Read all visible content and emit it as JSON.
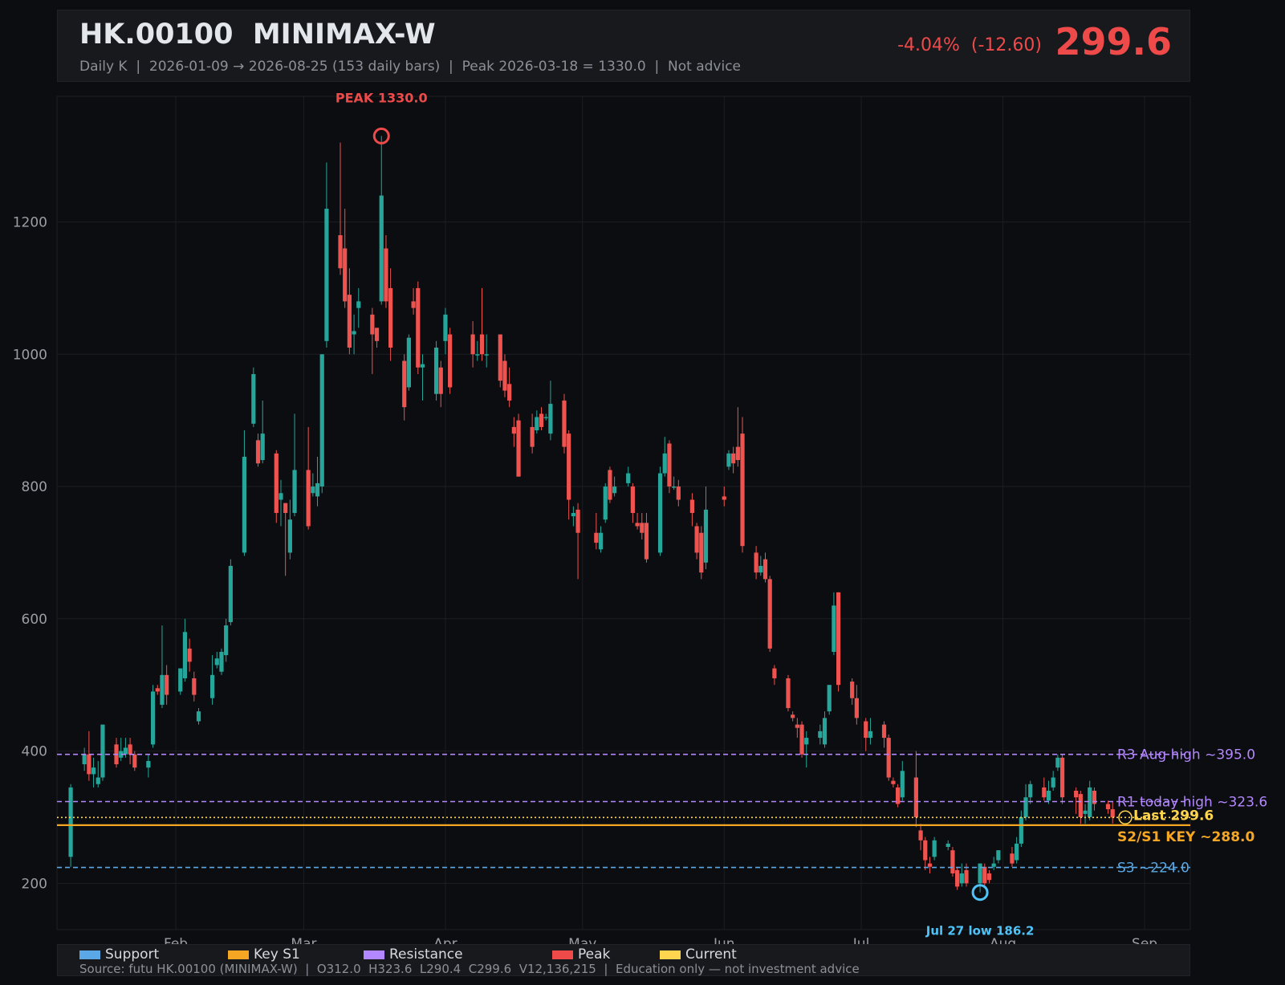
{
  "header": {
    "symbol": "HK.00100  MINIMAX-W",
    "subtitle": "Daily K  |  2026-01-09 → 2026-08-25 (153 daily bars)  |  Peak 2026-03-18 = 1330.0  |  Not advice",
    "change": "-4.04%  (-12.60)",
    "last": "299.6"
  },
  "colors": {
    "up": "#26a69a",
    "down": "#ef5350",
    "support": "#5aa9e6",
    "key": "#f5a623",
    "resistance": "#b388ff",
    "peak": "#ef4a4a",
    "current": "#ffd54f"
  },
  "chart_data": {
    "type": "candlestick",
    "ylim": [
      130,
      1390
    ],
    "yticks": [
      200,
      400,
      600,
      800,
      1000,
      1200
    ],
    "xticks": [
      {
        "label": "Feb",
        "date": "2026-02-01"
      },
      {
        "label": "Mar",
        "date": "2026-03-01"
      },
      {
        "label": "Apr",
        "date": "2026-04-01"
      },
      {
        "label": "May",
        "date": "2026-05-01"
      },
      {
        "label": "Jun",
        "date": "2026-06-01"
      },
      {
        "label": "Jul",
        "date": "2026-07-01"
      },
      {
        "label": "Aug",
        "date": "2026-08-01"
      },
      {
        "label": "Sep",
        "date": "2026-09-01"
      }
    ],
    "xrange": [
      "2026-01-06",
      "2026-09-11"
    ],
    "levels": [
      {
        "label": "R3 Aug high ~395.0",
        "value": 395.0,
        "kind": "resistance",
        "style": "dashed"
      },
      {
        "label": "R1 today high ~323.6",
        "value": 323.6,
        "kind": "resistance",
        "style": "dashed"
      },
      {
        "label": "Last 299.6",
        "value": 299.6,
        "kind": "current",
        "style": "dotted"
      },
      {
        "label": "S2/S1 KEY ~288.0",
        "value": 288.0,
        "kind": "key",
        "style": "solid"
      },
      {
        "label": "S3 ~224.0",
        "value": 224.0,
        "kind": "support",
        "style": "dashed"
      }
    ],
    "peak": {
      "label": "PEAK 1330.0",
      "date": "2026-03-18",
      "value": 1330.0
    },
    "low": {
      "label": "Jul 27 low 186.2",
      "date": "2026-07-27",
      "value": 186.2
    },
    "candles": [
      [
        "2026-01-09",
        240,
        345,
        350,
        225
      ],
      [
        "2026-01-12",
        380,
        395,
        405,
        370
      ],
      [
        "2026-01-13",
        395,
        365,
        430,
        355
      ],
      [
        "2026-01-14",
        365,
        375,
        390,
        345
      ],
      [
        "2026-01-15",
        350,
        360,
        385,
        345
      ],
      [
        "2026-01-16",
        360,
        440,
        440,
        355
      ],
      [
        "2026-01-19",
        410,
        380,
        420,
        375
      ],
      [
        "2026-01-20",
        390,
        400,
        420,
        385
      ],
      [
        "2026-01-21",
        395,
        405,
        420,
        390
      ],
      [
        "2026-01-22",
        410,
        395,
        420,
        380
      ],
      [
        "2026-01-23",
        395,
        375,
        400,
        370
      ],
      [
        "2026-01-26",
        375,
        385,
        395,
        360
      ],
      [
        "2026-01-27",
        410,
        490,
        500,
        405
      ],
      [
        "2026-01-28",
        495,
        490,
        500,
        485
      ],
      [
        "2026-01-29",
        470,
        515,
        590,
        465
      ],
      [
        "2026-01-30",
        515,
        485,
        530,
        470
      ],
      [
        "2026-02-02",
        490,
        525,
        525,
        485
      ],
      [
        "2026-02-03",
        510,
        580,
        600,
        505
      ],
      [
        "2026-02-04",
        555,
        535,
        570,
        520
      ],
      [
        "2026-02-05",
        510,
        485,
        520,
        475
      ],
      [
        "2026-02-06",
        445,
        460,
        465,
        440
      ],
      [
        "2026-02-09",
        480,
        515,
        545,
        470
      ],
      [
        "2026-02-10",
        530,
        540,
        550,
        525
      ],
      [
        "2026-02-11",
        520,
        550,
        555,
        515
      ],
      [
        "2026-02-12",
        545,
        590,
        600,
        535
      ],
      [
        "2026-02-13",
        595,
        680,
        690,
        590
      ],
      [
        "2026-02-16",
        700,
        845,
        885,
        695
      ],
      [
        "2026-02-18",
        895,
        970,
        980,
        890
      ],
      [
        "2026-02-19",
        870,
        835,
        880,
        830
      ],
      [
        "2026-02-20",
        840,
        880,
        930,
        835
      ],
      [
        "2026-02-23",
        850,
        760,
        855,
        745
      ],
      [
        "2026-02-24",
        780,
        790,
        810,
        740
      ],
      [
        "2026-02-25",
        775,
        760,
        775,
        665
      ],
      [
        "2026-02-26",
        700,
        750,
        780,
        690
      ],
      [
        "2026-02-27",
        760,
        825,
        910,
        755
      ],
      [
        "2026-03-02",
        825,
        740,
        890,
        735
      ],
      [
        "2026-03-03",
        790,
        800,
        820,
        785
      ],
      [
        "2026-03-04",
        785,
        805,
        845,
        770
      ],
      [
        "2026-03-05",
        800,
        1000,
        1000,
        790
      ],
      [
        "2026-03-06",
        1020,
        1220,
        1290,
        1010
      ],
      [
        "2026-03-09",
        1180,
        1130,
        1320,
        1120
      ],
      [
        "2026-03-10",
        1160,
        1080,
        1220,
        1070
      ],
      [
        "2026-03-11",
        1090,
        1010,
        1130,
        1000
      ],
      [
        "2026-03-12",
        1030,
        1035,
        1060,
        1000
      ],
      [
        "2026-03-13",
        1070,
        1080,
        1100,
        1040
      ],
      [
        "2026-03-16",
        1060,
        1030,
        1070,
        970
      ],
      [
        "2026-03-17",
        1040,
        1020,
        1040,
        1010
      ],
      [
        "2026-03-18",
        1080,
        1240,
        1330,
        1075
      ],
      [
        "2026-03-19",
        1160,
        1080,
        1180,
        1070
      ],
      [
        "2026-03-20",
        1100,
        1010,
        1130,
        990
      ],
      [
        "2026-03-23",
        990,
        920,
        1000,
        900
      ],
      [
        "2026-03-24",
        950,
        1025,
        1030,
        945
      ],
      [
        "2026-03-25",
        1080,
        1070,
        1100,
        1060
      ],
      [
        "2026-03-26",
        1100,
        980,
        1110,
        970
      ],
      [
        "2026-03-27",
        980,
        985,
        1000,
        930
      ],
      [
        "2026-03-30",
        940,
        1010,
        1020,
        930
      ],
      [
        "2026-03-31",
        980,
        940,
        990,
        920
      ],
      [
        "2026-04-01",
        1020,
        1060,
        1070,
        1000
      ],
      [
        "2026-04-02",
        1030,
        950,
        1040,
        940
      ],
      [
        "2026-04-07",
        1030,
        1000,
        1050,
        980
      ],
      [
        "2026-04-08",
        1000,
        1000,
        1020,
        990
      ],
      [
        "2026-04-09",
        1030,
        1000,
        1100,
        990
      ],
      [
        "2026-04-10",
        1000,
        1000,
        1030,
        980
      ],
      [
        "2026-04-13",
        1030,
        960,
        1030,
        950
      ],
      [
        "2026-04-14",
        990,
        945,
        1000,
        935
      ],
      [
        "2026-04-15",
        955,
        930,
        980,
        920
      ],
      [
        "2026-04-16",
        890,
        880,
        905,
        860
      ],
      [
        "2026-04-17",
        900,
        815,
        910,
        815
      ],
      [
        "2026-04-20",
        890,
        860,
        910,
        850
      ],
      [
        "2026-04-21",
        885,
        905,
        915,
        880
      ],
      [
        "2026-04-22",
        910,
        890,
        920,
        885
      ],
      [
        "2026-04-23",
        905,
        905,
        910,
        900
      ],
      [
        "2026-04-24",
        880,
        925,
        960,
        870
      ],
      [
        "2026-04-27",
        930,
        860,
        940,
        850
      ],
      [
        "2026-04-28",
        880,
        780,
        885,
        750
      ],
      [
        "2026-04-29",
        755,
        760,
        770,
        740
      ],
      [
        "2026-04-30",
        765,
        730,
        775,
        660
      ],
      [
        "2026-05-04",
        730,
        715,
        760,
        705
      ],
      [
        "2026-05-05",
        705,
        730,
        740,
        700
      ],
      [
        "2026-05-06",
        750,
        800,
        805,
        745
      ],
      [
        "2026-05-07",
        825,
        780,
        830,
        775
      ],
      [
        "2026-05-08",
        790,
        800,
        815,
        785
      ],
      [
        "2026-05-11",
        805,
        820,
        830,
        800
      ],
      [
        "2026-05-12",
        800,
        760,
        805,
        745
      ],
      [
        "2026-05-13",
        745,
        740,
        760,
        735
      ],
      [
        "2026-05-14",
        745,
        730,
        760,
        720
      ],
      [
        "2026-05-15",
        745,
        690,
        760,
        685
      ],
      [
        "2026-05-18",
        700,
        820,
        830,
        695
      ],
      [
        "2026-05-19",
        820,
        850,
        875,
        815
      ],
      [
        "2026-05-20",
        865,
        800,
        870,
        790
      ],
      [
        "2026-05-21",
        800,
        800,
        815,
        795
      ],
      [
        "2026-05-22",
        800,
        780,
        810,
        770
      ],
      [
        "2026-05-25",
        780,
        760,
        790,
        740
      ],
      [
        "2026-05-26",
        740,
        700,
        745,
        690
      ],
      [
        "2026-05-27",
        730,
        670,
        740,
        660
      ],
      [
        "2026-05-28",
        685,
        765,
        800,
        675
      ],
      [
        "2026-06-01",
        785,
        780,
        800,
        770
      ],
      [
        "2026-06-02",
        830,
        850,
        855,
        825
      ],
      [
        "2026-06-03",
        850,
        835,
        860,
        820
      ],
      [
        "2026-06-04",
        860,
        840,
        920,
        830
      ],
      [
        "2026-06-05",
        880,
        710,
        905,
        700
      ],
      [
        "2026-06-08",
        700,
        670,
        710,
        660
      ],
      [
        "2026-06-09",
        670,
        680,
        695,
        665
      ],
      [
        "2026-06-10",
        690,
        660,
        700,
        655
      ],
      [
        "2026-06-11",
        660,
        555,
        665,
        550
      ],
      [
        "2026-06-12",
        525,
        510,
        530,
        500
      ],
      [
        "2026-06-15",
        510,
        465,
        515,
        460
      ],
      [
        "2026-06-16",
        455,
        450,
        460,
        445
      ],
      [
        "2026-06-17",
        440,
        435,
        450,
        420
      ],
      [
        "2026-06-18",
        440,
        395,
        445,
        390
      ],
      [
        "2026-06-19",
        410,
        420,
        430,
        375
      ],
      [
        "2026-06-22",
        420,
        430,
        440,
        410
      ],
      [
        "2026-06-23",
        410,
        450,
        460,
        405
      ],
      [
        "2026-06-24",
        460,
        500,
        500,
        455
      ],
      [
        "2026-06-25",
        550,
        620,
        640,
        545
      ],
      [
        "2026-06-26",
        640,
        500,
        640,
        490
      ],
      [
        "2026-06-29",
        505,
        480,
        510,
        470
      ],
      [
        "2026-06-30",
        480,
        450,
        500,
        440
      ],
      [
        "2026-07-02",
        445,
        420,
        450,
        400
      ],
      [
        "2026-07-03",
        420,
        430,
        450,
        410
      ],
      [
        "2026-07-06",
        440,
        420,
        445,
        405
      ],
      [
        "2026-07-07",
        420,
        360,
        425,
        355
      ],
      [
        "2026-07-08",
        355,
        350,
        360,
        345
      ],
      [
        "2026-07-09",
        345,
        320,
        350,
        315
      ],
      [
        "2026-07-10",
        330,
        370,
        385,
        325
      ],
      [
        "2026-07-13",
        360,
        300,
        400,
        285
      ],
      [
        "2026-07-14",
        280,
        265,
        290,
        250
      ],
      [
        "2026-07-15",
        265,
        235,
        270,
        220
      ],
      [
        "2026-07-16",
        230,
        225,
        240,
        215
      ],
      [
        "2026-07-17",
        240,
        265,
        270,
        235
      ],
      [
        "2026-07-20",
        255,
        260,
        265,
        250
      ],
      [
        "2026-07-21",
        250,
        215,
        255,
        210
      ],
      [
        "2026-07-22",
        220,
        195,
        225,
        190
      ],
      [
        "2026-07-23",
        200,
        215,
        230,
        195
      ],
      [
        "2026-07-24",
        220,
        200,
        230,
        195
      ],
      [
        "2026-07-27",
        200,
        230,
        230,
        186.2
      ],
      [
        "2026-07-28",
        225,
        200,
        230,
        195
      ],
      [
        "2026-07-29",
        215,
        205,
        220,
        200
      ],
      [
        "2026-07-30",
        225,
        230,
        240,
        220
      ],
      [
        "2026-07-31",
        235,
        250,
        250,
        230
      ],
      [
        "2026-08-03",
        245,
        230,
        255,
        225
      ],
      [
        "2026-08-04",
        235,
        260,
        270,
        230
      ],
      [
        "2026-08-05",
        260,
        300,
        310,
        255
      ],
      [
        "2026-08-06",
        300,
        330,
        350,
        295
      ],
      [
        "2026-08-07",
        330,
        350,
        355,
        320
      ],
      [
        "2026-08-10",
        345,
        330,
        360,
        325
      ],
      [
        "2026-08-11",
        325,
        340,
        355,
        320
      ],
      [
        "2026-08-12",
        345,
        360,
        370,
        340
      ],
      [
        "2026-08-13",
        375,
        390,
        395,
        370
      ],
      [
        "2026-08-14",
        390,
        330,
        395,
        320
      ],
      [
        "2026-08-17",
        340,
        330,
        345,
        305
      ],
      [
        "2026-08-18",
        335,
        300,
        340,
        290
      ],
      [
        "2026-08-19",
        305,
        310,
        320,
        290
      ],
      [
        "2026-08-20",
        300,
        345,
        355,
        295
      ],
      [
        "2026-08-21",
        340,
        320,
        345,
        310
      ],
      [
        "2026-08-24",
        320,
        312,
        325,
        305
      ],
      [
        "2026-08-25",
        312,
        299.6,
        323.6,
        290.4
      ]
    ]
  },
  "legend": {
    "items": [
      {
        "label": "Support",
        "color": "#5aa9e6"
      },
      {
        "label": "Key S1",
        "color": "#f5a623"
      },
      {
        "label": "Resistance",
        "color": "#b388ff"
      },
      {
        "label": "Peak",
        "color": "#ef4a4a"
      },
      {
        "label": "Current",
        "color": "#ffd54f"
      }
    ],
    "source": "Source: futu HK.00100 (MINIMAX-W)  |  O312.0  H323.6  L290.4  C299.6  V12,136,215  |  Education only — not investment advice"
  }
}
